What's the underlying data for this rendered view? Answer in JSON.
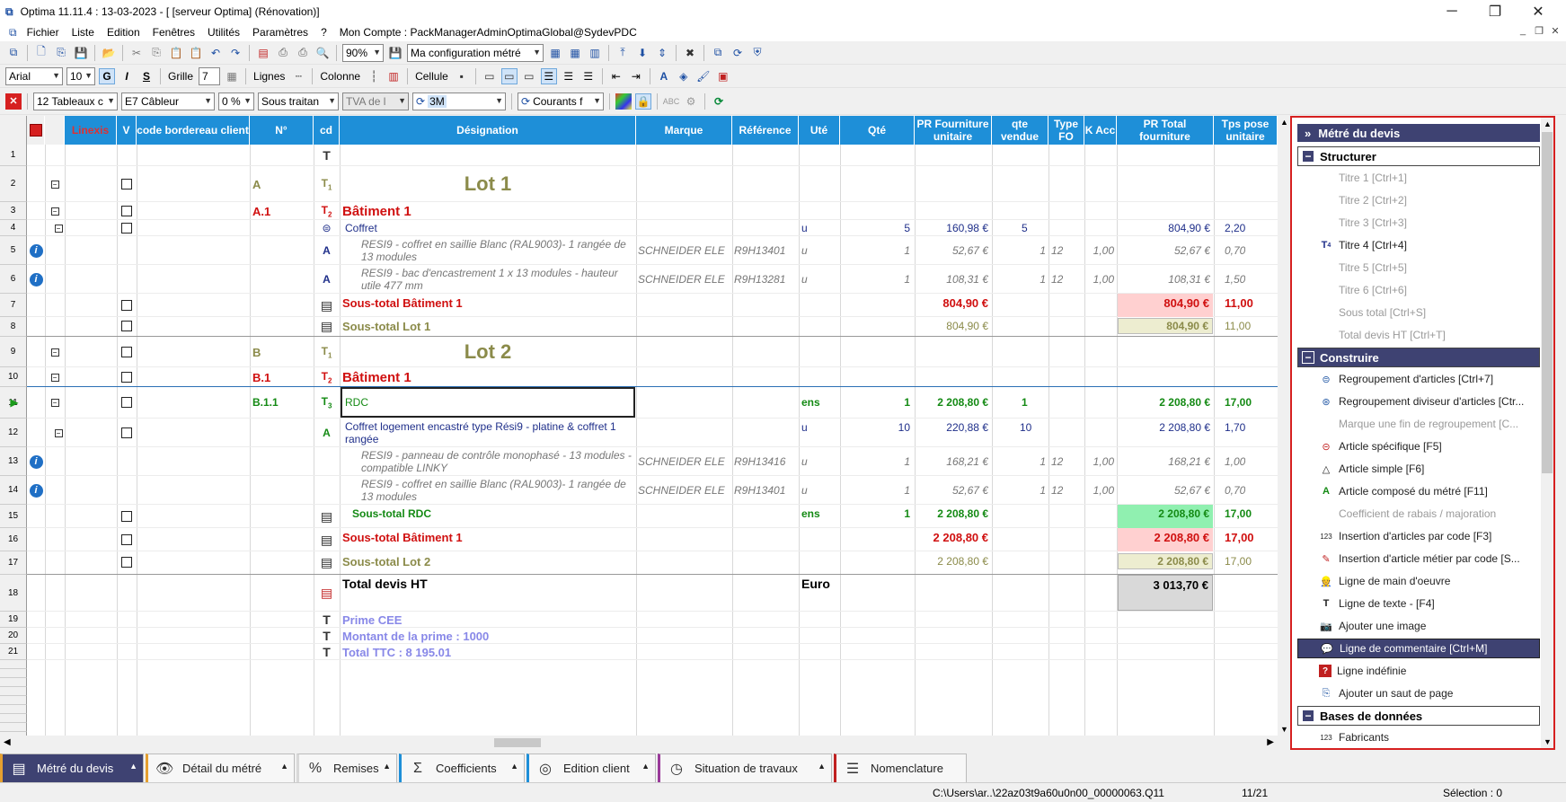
{
  "window": {
    "title": "Optima 11.11.4 : 13-03-2023 - [ [serveur Optima] (Rénovation)]"
  },
  "menu": [
    "Fichier",
    "Liste",
    "Edition",
    "Fenêtres",
    "Utilités",
    "Paramètres",
    "?",
    "Mon Compte : PackManagerAdminOptimaGlobal@SydevPDC"
  ],
  "toolbar1": {
    "zoom": "90%",
    "config": "Ma configuration métré"
  },
  "toolbar2": {
    "font": "Arial",
    "size": "10",
    "grille": "Grille",
    "grille_val": "7",
    "lignes": "Lignes",
    "colonne": "Colonne",
    "cellule": "Cellule"
  },
  "toolbar3": {
    "tableaux": "12 Tableaux c",
    "cableur": "E7  Câbleur",
    "pct": "0 %",
    "sous_traitant": "Sous traitan",
    "tva": "TVA de l",
    "mode": "3M",
    "courants": "Courants f"
  },
  "columns": [
    "Linexis",
    "V",
    "code bordereau client",
    "N°",
    "cd",
    "Désignation",
    "Marque",
    "Référence",
    "Uté",
    "Qté",
    "PR Fourniture unitaire",
    "qte vendue",
    "Type FO",
    "K Acc",
    "PR Total fourniture",
    "Tps pose unitaire"
  ],
  "rows": [
    {
      "n": "1"
    },
    {
      "n": "2",
      "num": "A",
      "des": "Lot 1"
    },
    {
      "n": "3",
      "num": "A.1",
      "des": "Bâtiment 1"
    },
    {
      "n": "4",
      "des": "Coffret",
      "ute": "u",
      "qte": "5",
      "pru": "160,98 €",
      "qv": "5",
      "prt": "804,90 €",
      "tps": "2,20"
    },
    {
      "n": "5",
      "des": "RESI9 - coffret en saillie Blanc (RAL9003)- 1 rangée de 13 modules",
      "marque": "SCHNEIDER ELE",
      "ref": "R9H13401",
      "ute": "u",
      "qte": "1",
      "pru": "52,67 €",
      "qv": "1",
      "type": "12",
      "k": "1,00",
      "prt": "52,67 €",
      "tps": "0,70"
    },
    {
      "n": "6",
      "des": "RESI9 - bac d'encastrement 1 x 13 modules - hauteur utile 477 mm",
      "marque": "SCHNEIDER ELE",
      "ref": "R9H13281",
      "ute": "u",
      "qte": "1",
      "pru": "108,31 €",
      "qv": "1",
      "type": "12",
      "k": "1,00",
      "prt": "108,31 €",
      "tps": "1,50"
    },
    {
      "n": "7",
      "des": "Sous-total Bâtiment 1",
      "pru": "804,90 €",
      "prt": "804,90 €",
      "tps": "11,00"
    },
    {
      "n": "8",
      "des": "Sous-total Lot 1",
      "pru": "804,90 €",
      "prt": "804,90 €",
      "tps": "11,00"
    },
    {
      "n": "9",
      "num": "B",
      "des": "Lot 2"
    },
    {
      "n": "10",
      "num": "B.1",
      "des": "Bâtiment 1"
    },
    {
      "n": "11",
      "num": "B.1.1",
      "des": "RDC",
      "ute": "ens",
      "qte": "1",
      "pru": "2 208,80 €",
      "qv": "1",
      "prt": "2 208,80 €",
      "tps": "17,00"
    },
    {
      "n": "12",
      "des": "Coffret logement encastré type Rési9 - platine & coffret 1 rangée",
      "ute": "u",
      "qte": "10",
      "pru": "220,88 €",
      "qv": "10",
      "prt": "2 208,80 €",
      "tps": "1,70"
    },
    {
      "n": "13",
      "des": "RESI9 - panneau de contrôle monophasé - 13 modules - compatible LINKY",
      "marque": "SCHNEIDER ELE",
      "ref": "R9H13416",
      "ute": "u",
      "qte": "1",
      "pru": "168,21 €",
      "qv": "1",
      "type": "12",
      "k": "1,00",
      "prt": "168,21 €",
      "tps": "1,00"
    },
    {
      "n": "14",
      "des": "RESI9 - coffret en saillie Blanc (RAL9003)- 1 rangée de 13 modules",
      "marque": "SCHNEIDER ELE",
      "ref": "R9H13401",
      "ute": "u",
      "qte": "1",
      "pru": "52,67 €",
      "qv": "1",
      "type": "12",
      "k": "1,00",
      "prt": "52,67 €",
      "tps": "0,70"
    },
    {
      "n": "15",
      "des": "Sous-total RDC",
      "ute": "ens",
      "qte": "1",
      "pru": "2 208,80 €",
      "prt": "2 208,80 €",
      "tps": "17,00"
    },
    {
      "n": "16",
      "des": "Sous-total Bâtiment 1",
      "pru": "2 208,80 €",
      "prt": "2 208,80 €",
      "tps": "17,00"
    },
    {
      "n": "17",
      "des": "Sous-total Lot 2",
      "pru": "2 208,80 €",
      "prt": "2 208,80 €",
      "tps": "17,00"
    },
    {
      "n": "18",
      "des": "Total devis HT",
      "ute": "Euro",
      "prt": "3 013,70 €"
    },
    {
      "n": "19",
      "des": "Prime CEE"
    },
    {
      "n": "20",
      "des": "Montant  de la prime : 1000"
    },
    {
      "n": "21",
      "des": "Total TTC : 8 195.01"
    }
  ],
  "panel": {
    "title": "Métré du devis",
    "structurer": "Structurer",
    "structurer_items": [
      "Titre 1 [Ctrl+1]",
      "Titre 2 [Ctrl+2]",
      "Titre 3 [Ctrl+3]",
      "Titre 4 [Ctrl+4]",
      "Titre 5 [Ctrl+5]",
      "Titre 6 [Ctrl+6]",
      "Sous total [Ctrl+S]",
      "Total devis HT [Ctrl+T]"
    ],
    "construire": "Construire",
    "construire_items": [
      "Regroupement d'articles  [Ctrl+7]",
      "Regroupement diviseur d'articles [Ctr...",
      "Marque une fin de regroupement  [C...",
      "Article spécifique [F5]",
      "Article simple [F6]",
      "Article composé du métré [F11]",
      "Coefficient de rabais / majoration",
      "Insertion d'articles par code [F3]",
      "Insertion d'article métier par code [S...",
      "Ligne de main d'oeuvre",
      "Ligne de texte - [F4]",
      "Ajouter une image",
      "Ligne de commentaire [Ctrl+M]",
      "Ligne indéfinie",
      "Ajouter un saut de page"
    ],
    "bases": "Bases de données",
    "bases_items": [
      "Fabricants"
    ]
  },
  "tabs": [
    "Métré du devis",
    "Détail du métré",
    "Remises",
    "Coefficients",
    "Edition client",
    "Situation de travaux",
    "Nomenclature"
  ],
  "status": {
    "path": "C:\\Users\\ar..\\22az03t9a60u0n00_00000063.Q11",
    "pos": "11/21",
    "selection": "Sélection : 0"
  }
}
